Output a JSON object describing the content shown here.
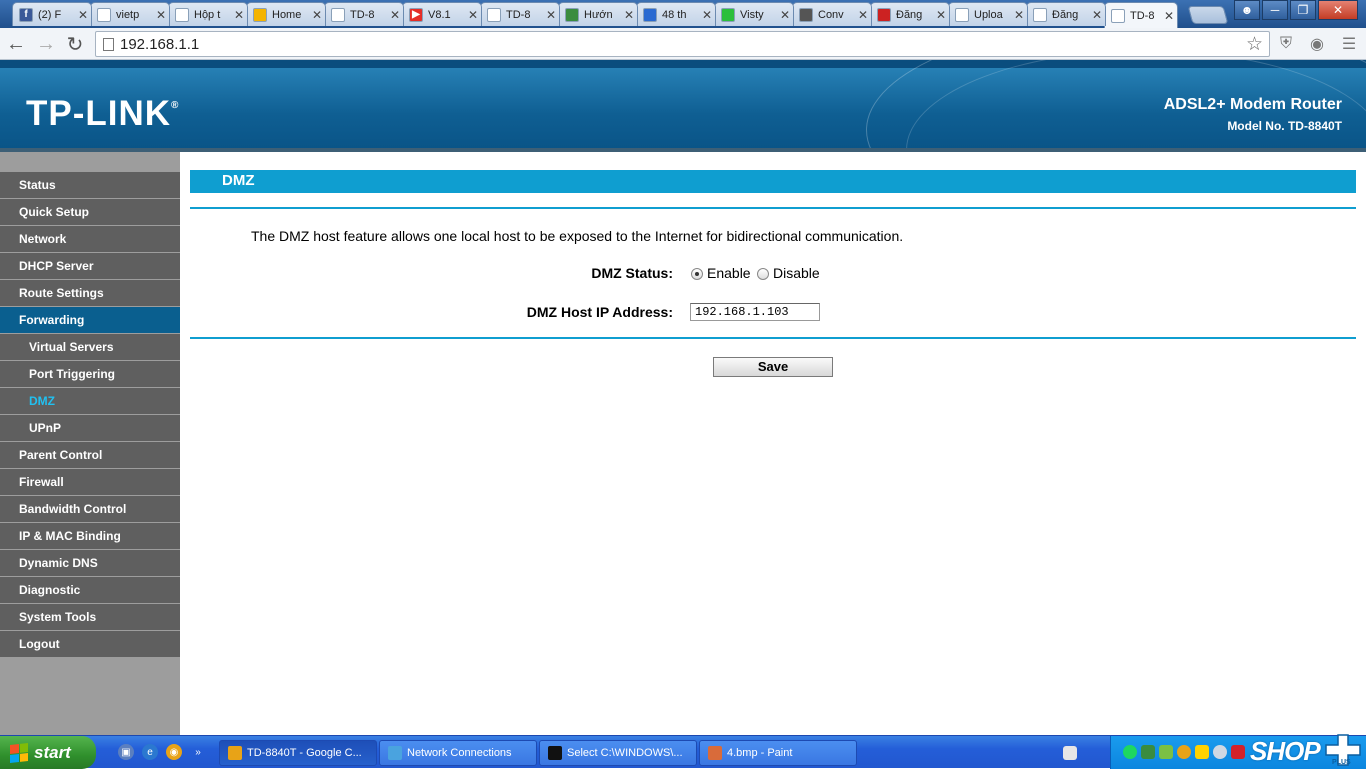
{
  "browser": {
    "tabs": [
      {
        "label": "(2) F",
        "color": "#3b5998",
        "glyph": "f"
      },
      {
        "label": "vietp",
        "color": "#ffffff",
        "glyph": "G"
      },
      {
        "label": "Hộp t",
        "color": "#ffffff",
        "glyph": "M"
      },
      {
        "label": "Home",
        "color": "#f4b400",
        "glyph": ""
      },
      {
        "label": "TD-8",
        "color": "#ffffff",
        "glyph": ""
      },
      {
        "label": "V8.1",
        "color": "#e52d27",
        "glyph": "▶"
      },
      {
        "label": "TD-8",
        "color": "#ffffff",
        "glyph": ""
      },
      {
        "label": "Hướn",
        "color": "#3a8c3f",
        "glyph": ""
      },
      {
        "label": "48 th",
        "color": "#2a6ad1",
        "glyph": ""
      },
      {
        "label": "Visty",
        "color": "#2bbf3c",
        "glyph": ""
      },
      {
        "label": "Conv",
        "color": "#555555",
        "glyph": ""
      },
      {
        "label": "Đăng",
        "color": "#cc2222",
        "glyph": ""
      },
      {
        "label": "Uploa",
        "color": "#ffffff",
        "glyph": ""
      },
      {
        "label": "Đăng",
        "color": "#ffffff",
        "glyph": ""
      },
      {
        "label": "TD-8",
        "color": "#ffffff",
        "glyph": ""
      }
    ],
    "url": "192.168.1.1"
  },
  "router": {
    "logo": "TP-LINK",
    "logo_mark": "®",
    "product": "ADSL2+ Modem Router",
    "model": "Model No. TD-8840T"
  },
  "sidebar": {
    "items": [
      {
        "label": "Status",
        "type": "top"
      },
      {
        "label": "Quick Setup",
        "type": "top"
      },
      {
        "label": "Network",
        "type": "top"
      },
      {
        "label": "DHCP Server",
        "type": "top"
      },
      {
        "label": "Route Settings",
        "type": "top"
      },
      {
        "label": "Forwarding",
        "type": "active-parent"
      },
      {
        "label": "Virtual Servers",
        "type": "sub"
      },
      {
        "label": "Port Triggering",
        "type": "sub"
      },
      {
        "label": "DMZ",
        "type": "current"
      },
      {
        "label": "UPnP",
        "type": "sub"
      },
      {
        "label": "Parent Control",
        "type": "top"
      },
      {
        "label": "Firewall",
        "type": "top"
      },
      {
        "label": "Bandwidth Control",
        "type": "top"
      },
      {
        "label": "IP & MAC Binding",
        "type": "top"
      },
      {
        "label": "Dynamic DNS",
        "type": "top"
      },
      {
        "label": "Diagnostic",
        "type": "top"
      },
      {
        "label": "System Tools",
        "type": "top"
      },
      {
        "label": "Logout",
        "type": "top"
      }
    ]
  },
  "content": {
    "title": "DMZ",
    "description": "The DMZ host feature allows one local host to be exposed to the Internet for bidirectional communication.",
    "dmz_status_label": "DMZ Status:",
    "enable_label": "Enable",
    "disable_label": "Disable",
    "dmz_status_value": "Enable",
    "host_ip_label": "DMZ Host IP Address:",
    "host_ip_value": "192.168.1.103",
    "save_label": "Save"
  },
  "taskbar": {
    "start_label": "start",
    "buttons": [
      {
        "label": "TD-8840T - Google C...",
        "color": "#e8a317"
      },
      {
        "label": "Network Connections",
        "color": "#4aa3df"
      },
      {
        "label": "Select C:\\WINDOWS\\...",
        "color": "#111111"
      },
      {
        "label": "4.bmp - Paint",
        "color": "#d96b3a"
      }
    ],
    "shop_logo": "SHOP",
    "shop_plus": "PLUS"
  }
}
